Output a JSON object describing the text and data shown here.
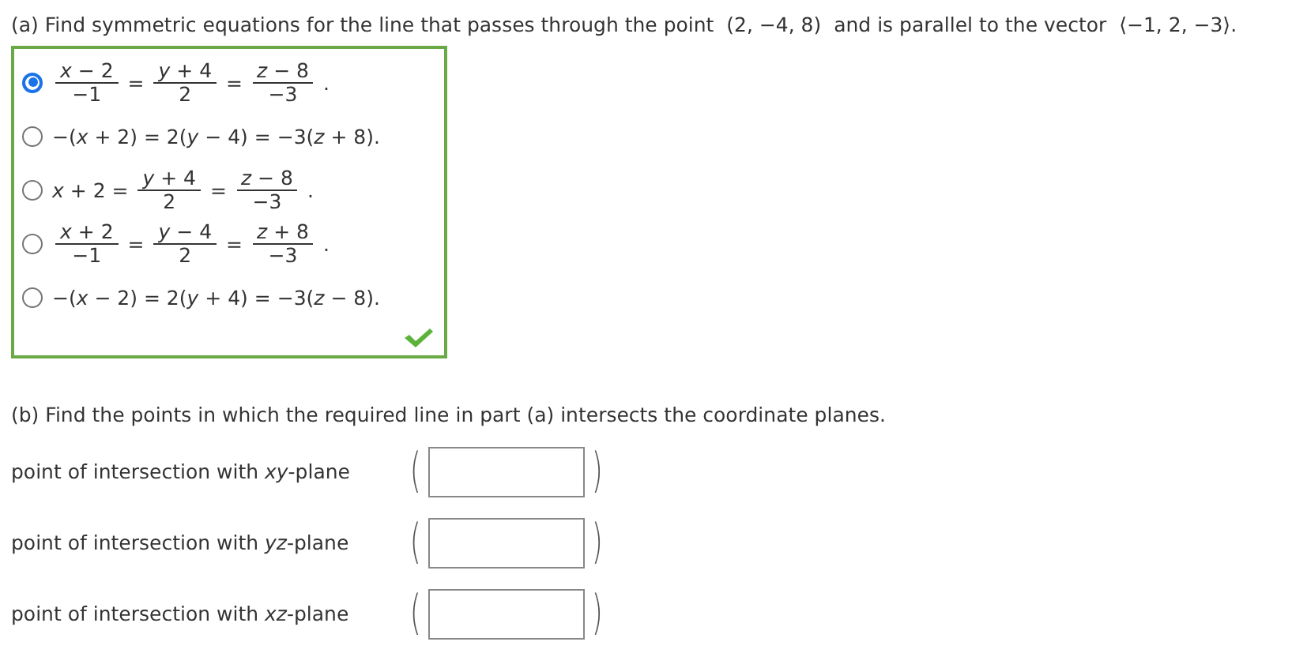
{
  "part_a": {
    "question": "(a) Find symmetric equations for the line that passes through the point  (2, −4, 8)  and is parallel to the vector  ⟨−1, 2, −3⟩.",
    "answer_box": {
      "correct": true,
      "options": [
        {
          "selected": true,
          "terms": [
            {
              "kind": "frac",
              "num": "*x* − 2",
              "den": "−1"
            },
            {
              "kind": "text",
              "text": "="
            },
            {
              "kind": "frac",
              "num": "*y* + 4",
              "den": "2"
            },
            {
              "kind": "text",
              "text": "="
            },
            {
              "kind": "frac",
              "num": "*z* − 8",
              "den": "−3"
            },
            {
              "kind": "text",
              "text": "."
            }
          ]
        },
        {
          "selected": false,
          "terms": [
            {
              "kind": "text",
              "text": "−(*x* + 2) = 2(*y* − 4) = −3(*z* + 8)."
            }
          ]
        },
        {
          "selected": false,
          "terms": [
            {
              "kind": "text",
              "text": "*x* + 2 ="
            },
            {
              "kind": "frac",
              "num": "*y* + 4",
              "den": "2"
            },
            {
              "kind": "text",
              "text": "="
            },
            {
              "kind": "frac",
              "num": "*z* − 8",
              "den": "−3"
            },
            {
              "kind": "text",
              "text": "."
            }
          ]
        },
        {
          "selected": false,
          "terms": [
            {
              "kind": "frac",
              "num": "*x* + 2",
              "den": "−1"
            },
            {
              "kind": "text",
              "text": "="
            },
            {
              "kind": "frac",
              "num": "*y* − 4",
              "den": "2"
            },
            {
              "kind": "text",
              "text": "="
            },
            {
              "kind": "frac",
              "num": "*z* + 8",
              "den": "−3"
            },
            {
              "kind": "text",
              "text": "."
            }
          ]
        },
        {
          "selected": false,
          "terms": [
            {
              "kind": "text",
              "text": "−(*x* − 2) = 2(*y* + 4) = −3(*z* − 8)."
            }
          ]
        }
      ]
    }
  },
  "part_b": {
    "question": "(b) Find the points in which the required line in part (a) intersects the coordinate planes.",
    "rows": [
      {
        "label": "point of intersection with *xy*-plane",
        "open": "(",
        "close": ")"
      },
      {
        "label": "point of intersection with *yz*-plane",
        "open": "(",
        "close": ")"
      },
      {
        "label": "point of intersection with *xz*-plane",
        "open": "(",
        "close": ")"
      }
    ]
  }
}
